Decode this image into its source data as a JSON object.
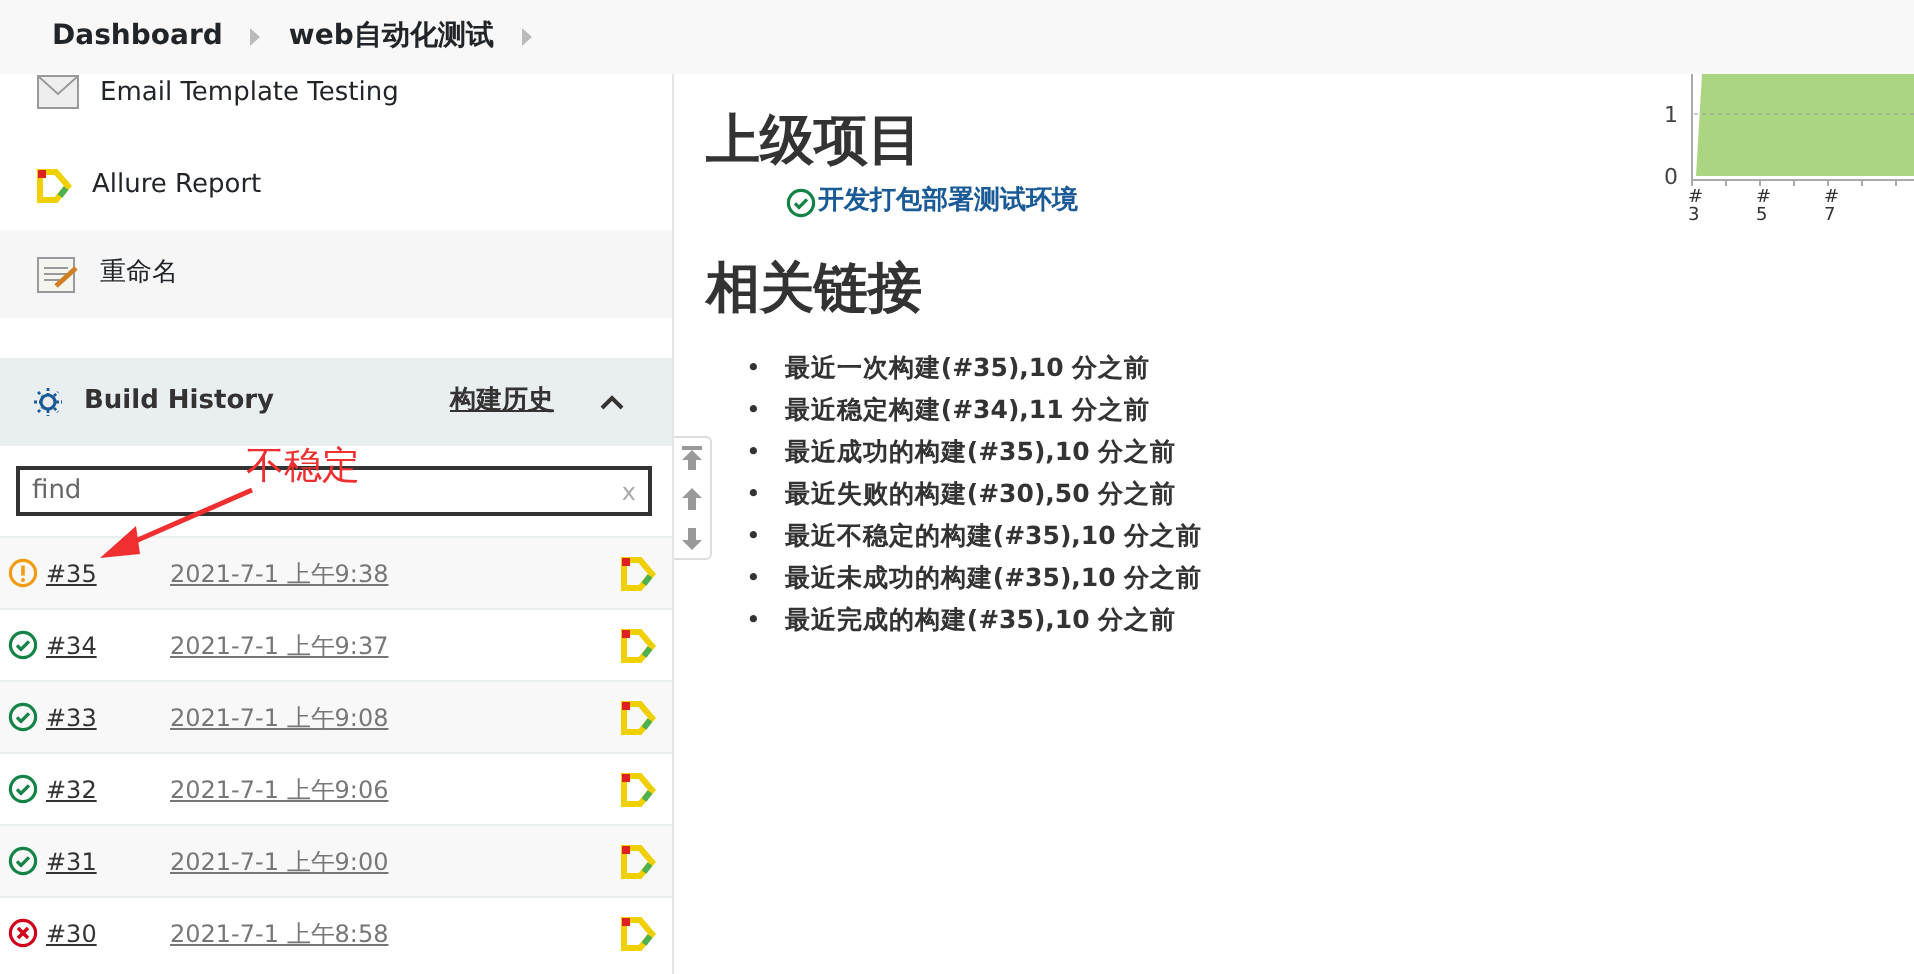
{
  "breadcrumb": [
    {
      "label": "Dashboard"
    },
    {
      "label": "web自动化测试"
    }
  ],
  "sidebar": {
    "items": [
      {
        "label": "Email Template Testing",
        "kind": "email"
      },
      {
        "label": "Allure Report",
        "kind": "allure"
      },
      {
        "label": "重命名",
        "kind": "rename"
      }
    ]
  },
  "build_history": {
    "title": "Build History",
    "link": "构建历史",
    "expanded": true,
    "search": {
      "placeholder": "find",
      "clear": "x"
    },
    "builds": [
      {
        "number": "#35",
        "date": "2021-7-1 上午9:38",
        "kind": "unstable"
      },
      {
        "number": "#34",
        "date": "2021-7-1 上午9:37",
        "kind": "success"
      },
      {
        "number": "#33",
        "date": "2021-7-1 上午9:08",
        "kind": "success"
      },
      {
        "number": "#32",
        "date": "2021-7-1 上午9:06",
        "kind": "success"
      },
      {
        "number": "#31",
        "date": "2021-7-1 上午9:00",
        "kind": "success"
      },
      {
        "number": "#30",
        "date": "2021-7-1 上午8:58",
        "kind": "failed"
      }
    ]
  },
  "upstream": {
    "title": "上级项目",
    "projects": [
      {
        "label": "开发打包部署测试环境",
        "kind": "success"
      }
    ]
  },
  "links": {
    "title": "相关链接",
    "items": [
      {
        "bullet": "•",
        "label": "最近一次构建(#35),10 分之前"
      },
      {
        "bullet": "•",
        "label": "最近稳定构建(#34),11 分之前"
      },
      {
        "bullet": "•",
        "label": "最近成功的构建(#35),10 分之前"
      },
      {
        "bullet": "•",
        "label": "最近失败的构建(#30),50 分之前"
      },
      {
        "bullet": "•",
        "label": "最近不稳定的构建(#35),10 分之前"
      },
      {
        "bullet": "•",
        "label": "最近未成功的构建(#35),10 分之前"
      },
      {
        "bullet": "•",
        "label": "最近完成的构建(#35),10 分之前"
      }
    ]
  },
  "trend": {
    "y_labels": [
      "1",
      "0"
    ],
    "x_labels": [
      "#3",
      "#5",
      "#7"
    ]
  },
  "annotation": {
    "text": "不稳定"
  }
}
